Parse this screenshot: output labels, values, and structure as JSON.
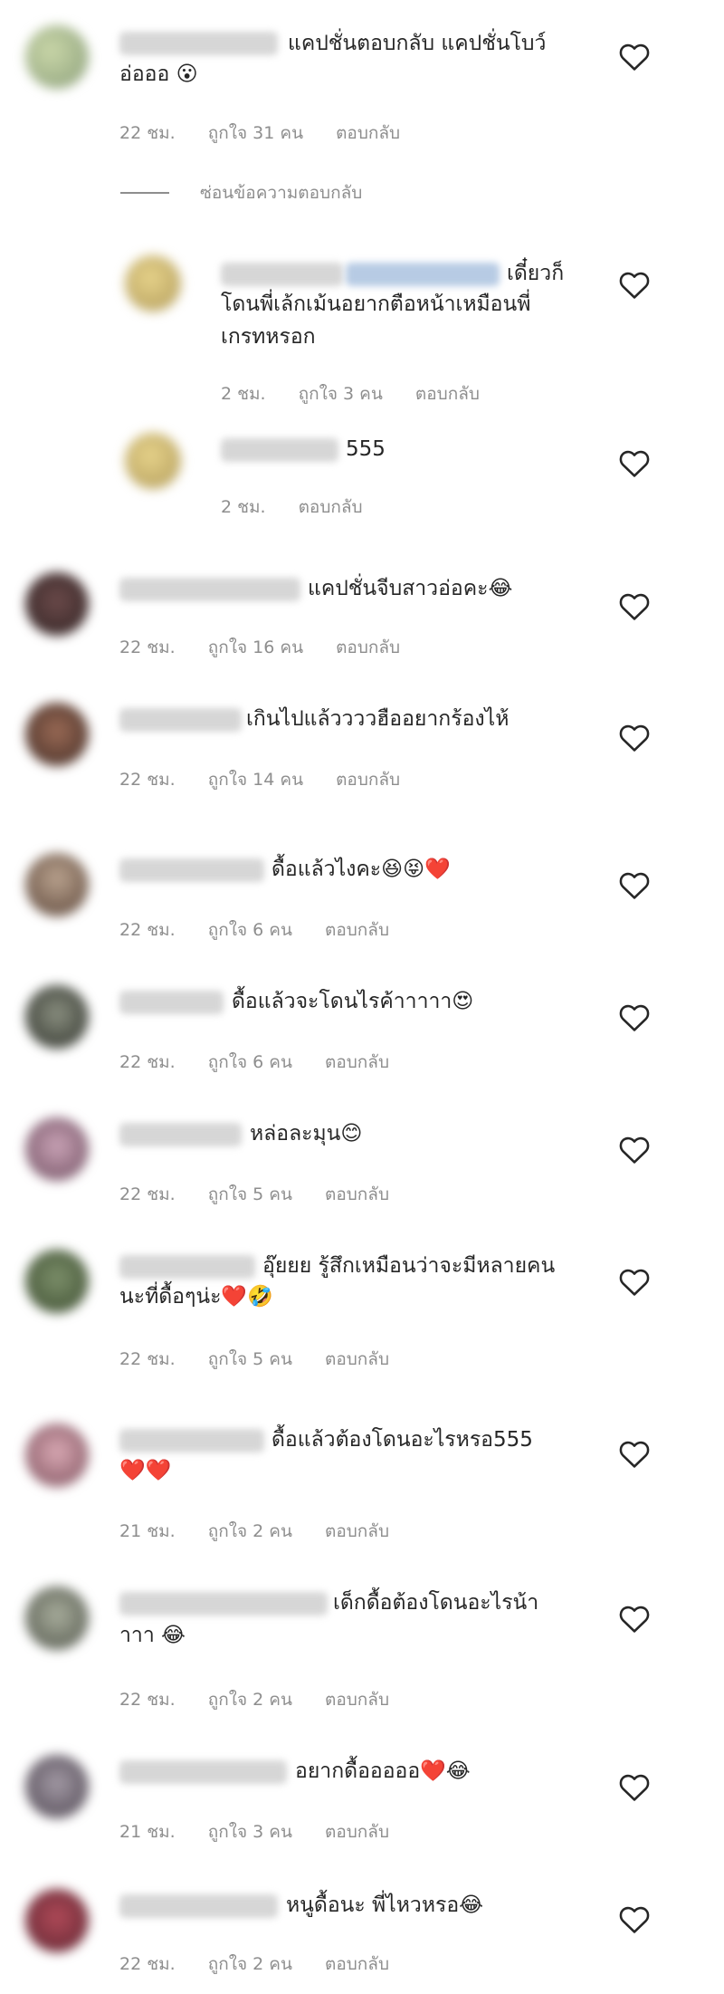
{
  "hide_replies_label": "ซ่อนข้อความตอบกลับ",
  "comments": [
    {
      "text": [
        "แคปชั่นตอบกลับ แคปชั่นโบว์",
        "อ่อออ 😮"
      ],
      "time": "22 ชม.",
      "likes": "ถูกใจ 31 คน",
      "reply": "ตอบกลับ"
    },
    {
      "text": [
        "เดี๋ยวก็",
        "โดนพี่เล้กเม้นอยากตือหน้าเหมือนพี่",
        "เกรทหรอก"
      ],
      "time": "2 ชม.",
      "likes": "ถูกใจ 3 คน",
      "reply": "ตอบกลับ"
    },
    {
      "text": [
        "555"
      ],
      "time": "2 ชม.",
      "likes": "",
      "reply": "ตอบกลับ"
    },
    {
      "text": [
        "แคปชั่นจีบสาวอ่อคะ😂"
      ],
      "time": "22 ชม.",
      "likes": "ถูกใจ 16 คน",
      "reply": "ตอบกลับ"
    },
    {
      "text": [
        "เกินไปแล้ววววฮืออยากร้องไห้"
      ],
      "time": "22 ชม.",
      "likes": "ถูกใจ 14 คน",
      "reply": "ตอบกลับ"
    },
    {
      "text": [
        "ดื้อแล้วไงคะ😆😝❤️"
      ],
      "time": "22 ชม.",
      "likes": "ถูกใจ 6 คน",
      "reply": "ตอบกลับ"
    },
    {
      "text": [
        "ดื้อแล้วจะโดนไรค้าาาาา😍"
      ],
      "time": "22 ชม.",
      "likes": "ถูกใจ 6 คน",
      "reply": "ตอบกลับ"
    },
    {
      "text": [
        "หล่อละมุน😊"
      ],
      "time": "22 ชม.",
      "likes": "ถูกใจ 5 คน",
      "reply": "ตอบกลับ"
    },
    {
      "text": [
        "อุ๊ยยย รู้สึกเหมือนว่าจะมีหลายคน",
        "นะที่ดื้อๆน่ะ❤️🤣"
      ],
      "time": "22 ชม.",
      "likes": "ถูกใจ 5 คน",
      "reply": "ตอบกลับ"
    },
    {
      "text": [
        "ดื้อแล้วต้องโดนอะไรหรอ555",
        "❤️❤️"
      ],
      "time": "21 ชม.",
      "likes": "ถูกใจ 2 คน",
      "reply": "ตอบกลับ"
    },
    {
      "text": [
        "เด็กดื้อต้องโดนอะไรน้า",
        "าาา 😂"
      ],
      "time": "22 ชม.",
      "likes": "ถูกใจ 2 คน",
      "reply": "ตอบกลับ"
    },
    {
      "text": [
        "อยากดื้อออออ❤️😂"
      ],
      "time": "21 ชม.",
      "likes": "ถูกใจ 3 คน",
      "reply": "ตอบกลับ"
    },
    {
      "text": [
        "หนูดื้อนะ พี่ไหวหรอ😂"
      ],
      "time": "22 ชม.",
      "likes": "ถูกใจ 2 คน",
      "reply": "ตอบกลับ"
    }
  ]
}
